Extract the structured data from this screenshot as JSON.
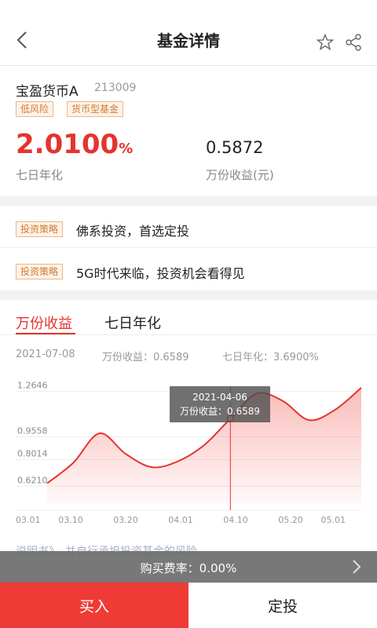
{
  "header": {
    "title": "基金详情",
    "back_icon": "chevron-left-icon",
    "favorite_icon": "star-icon",
    "share_icon": "share-icon"
  },
  "fund": {
    "name": "宝盈货币A",
    "code": "213009",
    "tags": [
      "低风险",
      "货币型基金"
    ],
    "seven_day_yield": "2.0100",
    "seven_day_yield_unit": "%",
    "seven_day_yield_label": "七日年化",
    "per_10k_income": "0.5872",
    "per_10k_income_label": "万份收益(元)"
  },
  "strategies": [
    {
      "tag": "投资策略",
      "text": "佛系投资，首选定投"
    },
    {
      "tag": "投资策略",
      "text": "5G时代来临，投资机会看得见"
    }
  ],
  "chart": {
    "tabs": [
      "万份收益",
      "七日年化"
    ],
    "active_tab": 0,
    "summary": {
      "date": "2021-07-08",
      "wan_label": "万份收益：0.6589",
      "qr_label": "七日年化：3.6900%"
    },
    "tooltip": {
      "date": "2021-04-06",
      "value_label": "万份收益：0.6589"
    },
    "accent_color": "#e5332e"
  },
  "chart_data": {
    "type": "area",
    "x": [
      "03.01",
      "03.05",
      "03.10",
      "03.15",
      "03.20",
      "03.25",
      "04.01",
      "04.06",
      "04.10",
      "04.15",
      "04.20",
      "04.25",
      "05.01"
    ],
    "values": [
      0.64,
      0.78,
      0.98,
      0.84,
      0.75,
      0.79,
      0.9,
      1.08,
      1.25,
      1.2,
      1.07,
      1.14,
      1.29
    ],
    "ylim": [
      0.5,
      1.38
    ],
    "yticks": [
      "1.2646",
      "0.9558",
      "0.8014",
      "0.6210"
    ],
    "ytick_values": [
      1.2646,
      0.9558,
      0.8014,
      0.621
    ],
    "xticks": [
      "03.01",
      "03.10",
      "03.20",
      "04.01",
      "04.10",
      "05.20",
      "05.01"
    ],
    "marker_x": "04.06"
  },
  "footer": {
    "disclaimer_partial": "说明书》，并自行承担投资基金的风险。",
    "fee_text": "购买费率：0.00%",
    "buy_label": "买入",
    "invest_label": "定投"
  }
}
